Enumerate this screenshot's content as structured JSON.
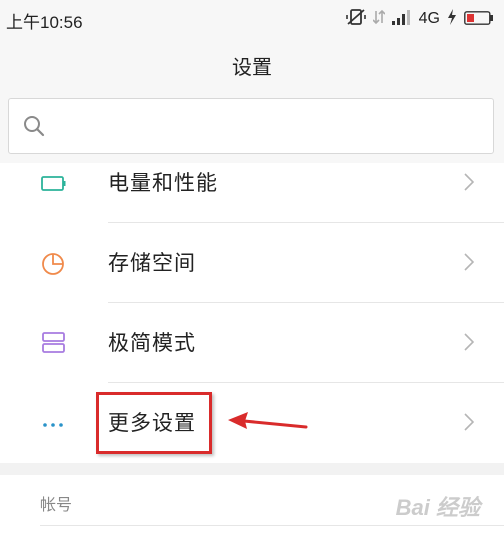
{
  "status_bar": {
    "time": "上午10:56",
    "network": "4G",
    "icons": [
      "vibrate-off-icon",
      "data-arrows-icon",
      "signal-icon",
      "charging-icon",
      "battery-icon"
    ]
  },
  "header": {
    "title": "设置"
  },
  "search": {
    "placeholder": "",
    "icon": "search-icon"
  },
  "settings_list": [
    {
      "label": "电量和性能",
      "icon": "battery-icon",
      "icon_color": "#2bb39a"
    },
    {
      "label": "存储空间",
      "icon": "pie-chart-icon",
      "icon_color": "#f08a4b"
    },
    {
      "label": "极简模式",
      "icon": "simple-mode-icon",
      "icon_color": "#a77be0"
    },
    {
      "label": "更多设置",
      "icon": "more-dots-icon",
      "icon_color": "#2a93c9"
    }
  ],
  "section": {
    "label": "帐号"
  },
  "annotation": {
    "highlight_color": "#d92b2b"
  },
  "watermark": {
    "text": "Bai 经验"
  }
}
